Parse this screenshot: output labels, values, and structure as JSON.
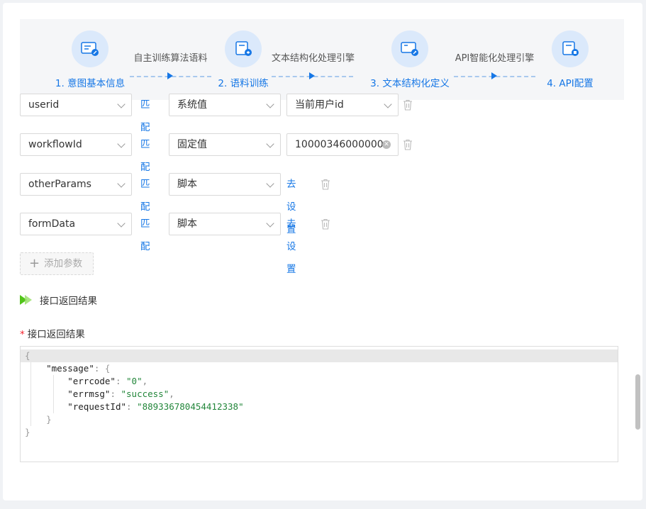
{
  "steps": [
    {
      "number": "1.",
      "label": "意图基本信息"
    },
    {
      "number": "2.",
      "label": "语料训练"
    },
    {
      "number": "3.",
      "label": "文本结构化定义"
    },
    {
      "number": "4.",
      "label": "API配置"
    }
  ],
  "connectors": [
    "自主训练算法语料",
    "文本结构化处理引擎",
    "API智能化处理引擎"
  ],
  "params": [
    {
      "name": "userid",
      "match": "匹配",
      "source": "系统值",
      "value": "当前用户id",
      "action": ""
    },
    {
      "name": "workflowId",
      "match": "匹配",
      "source": "固定值",
      "value": "10000346000000",
      "action": ""
    },
    {
      "name": "otherParams",
      "match": "匹配",
      "source": "脚本",
      "value": "",
      "action": "去设置"
    },
    {
      "name": "formData",
      "match": "匹配",
      "source": "脚本",
      "value": "",
      "action": "去设置"
    }
  ],
  "add_param_label": "添加参数",
  "section_title": "接口返回结果",
  "result_field_label": "接口返回结果",
  "code": {
    "open": "{",
    "message_key": "\"message\"",
    "errcode_key": "\"errcode\"",
    "errcode_val": "\"0\"",
    "errmsg_key": "\"errmsg\"",
    "errmsg_val": "\"success\"",
    "requestId_key": "\"requestId\"",
    "requestId_val": "\"889336780454412338\"",
    "close_inner": "}",
    "close": "}"
  },
  "colors": {
    "accent": "#1677e6",
    "play": "#52c41a",
    "required": "#f5222d",
    "string": "#22863a"
  }
}
